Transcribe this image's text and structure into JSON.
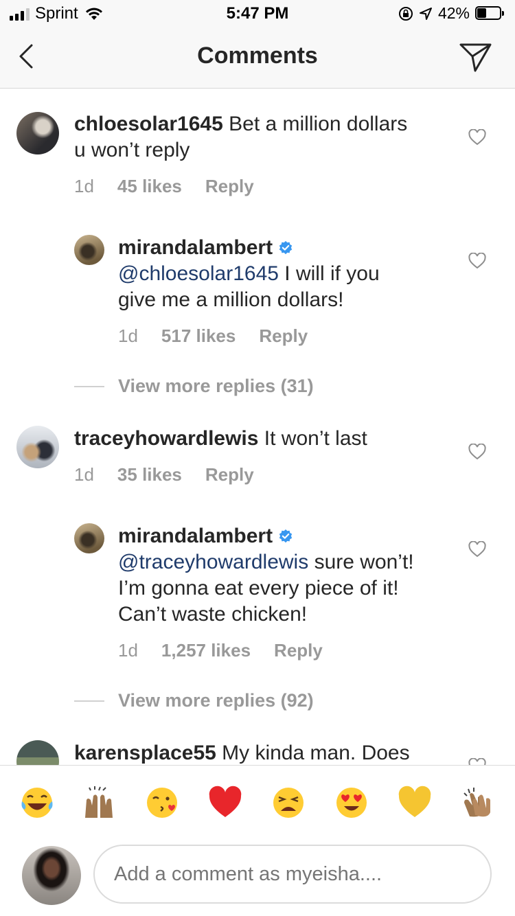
{
  "status": {
    "carrier": "Sprint",
    "time": "5:47 PM",
    "battery": "42%",
    "battery_level": 0.42
  },
  "nav": {
    "title": "Comments"
  },
  "comments": [
    {
      "user": "chloesolar1645",
      "text": "Bet a million dollars",
      "text2": "u won’t reply",
      "age": "1d",
      "likes": "45 likes",
      "reply": "Reply"
    },
    {
      "user": "mirandalambert",
      "mention": "@chloesolar1645",
      "text": "I will if you",
      "text2": "give me a million dollars!",
      "age": "1d",
      "likes": "517 likes",
      "reply": "Reply"
    },
    {
      "user": "traceyhowardlewis",
      "text": "It won’t last",
      "age": "1d",
      "likes": "35 likes",
      "reply": "Reply"
    },
    {
      "user": "mirandalambert",
      "mention": "@traceyhowardlewis",
      "text": "sure won’t!",
      "text2": "I’m gonna eat every piece of it!",
      "text3": "Can’t waste chicken!",
      "age": "1d",
      "likes": "1,257 likes",
      "reply": "Reply"
    },
    {
      "user": "karensplace55",
      "text": "My kinda man. Does"
    }
  ],
  "view_more": [
    "View more replies (31)",
    "View more replies (92)"
  ],
  "emoji_bar": [
    "😂",
    "🙌",
    "😘",
    "❤️",
    "😩",
    "😍",
    "💛",
    "👏"
  ],
  "composer": {
    "placeholder": "Add a comment as myeisha...."
  }
}
